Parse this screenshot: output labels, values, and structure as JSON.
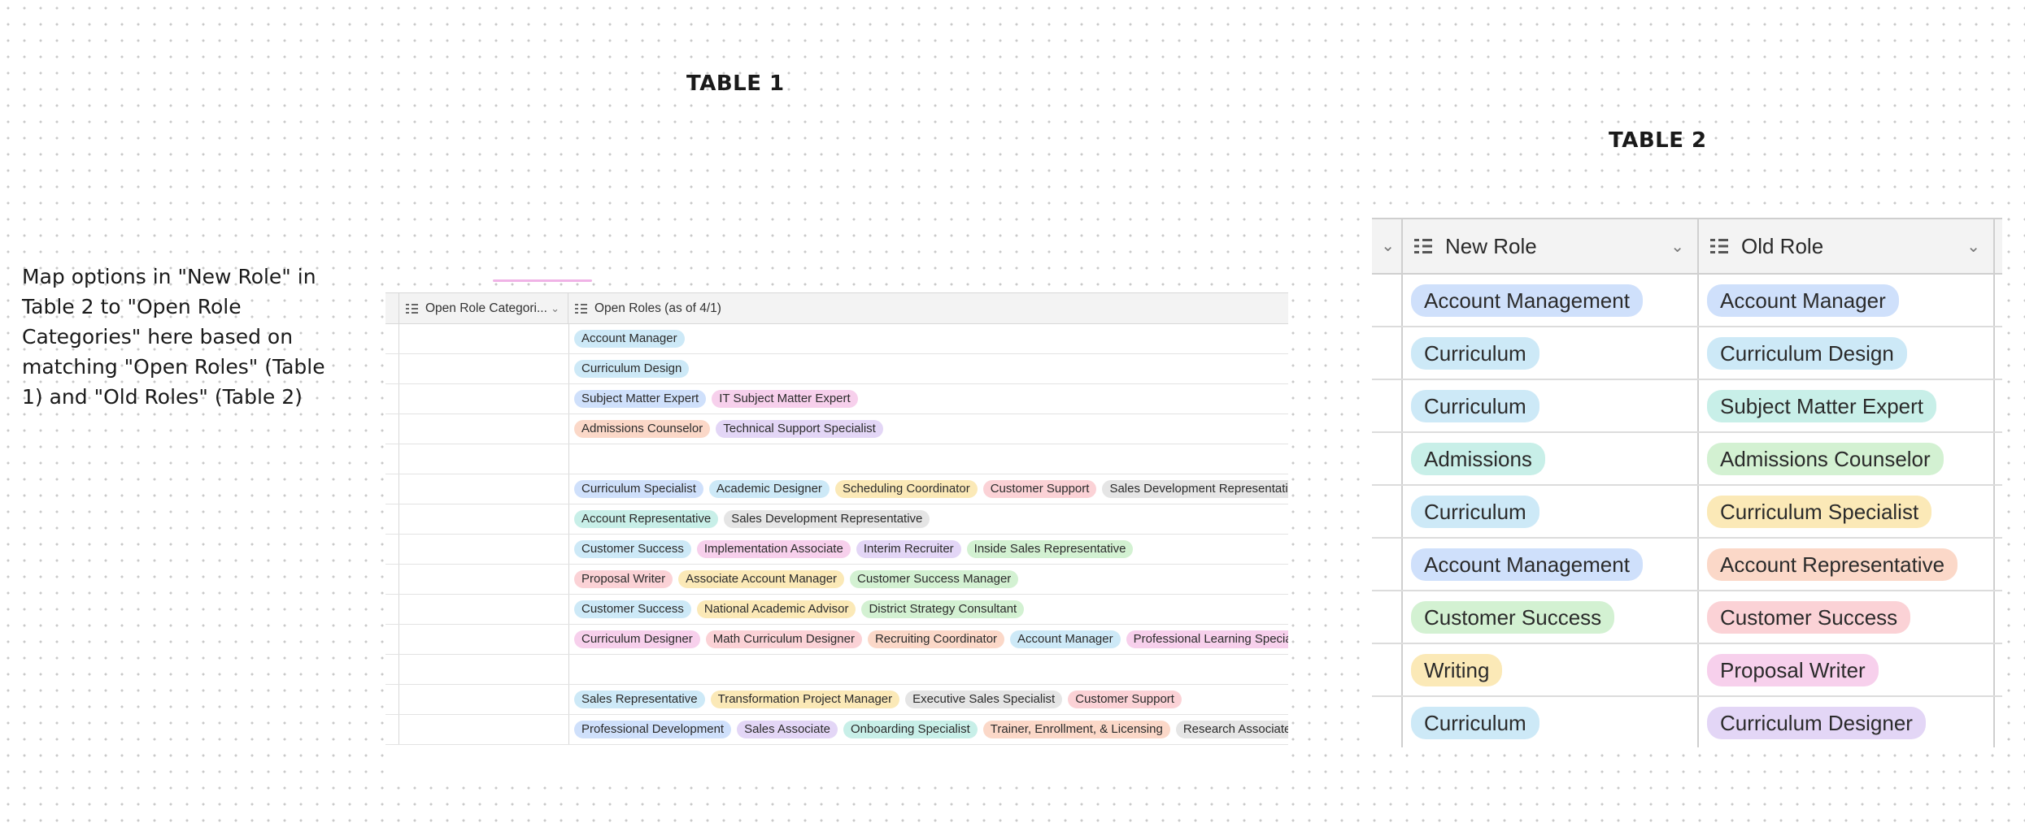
{
  "headings": {
    "table1": "TABLE 1",
    "table2": "TABLE 2"
  },
  "note": "Map options in \"New Role\" in Table 2 to \"Open Role Categories\" here based on matching \"Open Roles\" (Table 1) and \"Old Roles\" (Table 2)",
  "table1": {
    "columns": {
      "categories": "Open Role Categori...",
      "roles": "Open Roles (as of 4/1)"
    },
    "rows": [
      [
        {
          "label": "Account Manager",
          "color": "cyan"
        }
      ],
      [
        {
          "label": "Curriculum Design",
          "color": "cyan"
        }
      ],
      [
        {
          "label": "Subject Matter Expert",
          "color": "blue"
        },
        {
          "label": "IT Subject Matter Expert",
          "color": "pink"
        }
      ],
      [
        {
          "label": "Admissions Counselor",
          "color": "orange"
        },
        {
          "label": "Technical Support Specialist",
          "color": "purple"
        }
      ],
      [],
      [
        {
          "label": "Curriculum Specialist",
          "color": "blue"
        },
        {
          "label": "Academic Designer",
          "color": "cyan"
        },
        {
          "label": "Scheduling Coordinator",
          "color": "yellow"
        },
        {
          "label": "Customer Support",
          "color": "red"
        },
        {
          "label": "Sales Development Representative",
          "color": "gray"
        }
      ],
      [
        {
          "label": "Account Representative",
          "color": "teal"
        },
        {
          "label": "Sales Development Representative",
          "color": "gray"
        }
      ],
      [
        {
          "label": "Customer Success",
          "color": "cyan"
        },
        {
          "label": "Implementation Associate",
          "color": "pink"
        },
        {
          "label": "Interim Recruiter",
          "color": "purple"
        },
        {
          "label": "Inside Sales Representative",
          "color": "green"
        }
      ],
      [
        {
          "label": "Proposal Writer",
          "color": "red"
        },
        {
          "label": "Associate Account Manager",
          "color": "yellow"
        },
        {
          "label": "Customer Success Manager",
          "color": "green"
        }
      ],
      [
        {
          "label": "Customer Success",
          "color": "cyan"
        },
        {
          "label": "National Academic Advisor",
          "color": "yellow"
        },
        {
          "label": "District Strategy Consultant",
          "color": "green"
        }
      ],
      [
        {
          "label": "Curriculum Designer",
          "color": "pink"
        },
        {
          "label": "Math Curriculum Designer",
          "color": "red"
        },
        {
          "label": "Recruiting Coordinator",
          "color": "orange"
        },
        {
          "label": "Account Manager",
          "color": "cyan"
        },
        {
          "label": "Professional Learning Specialist",
          "color": "pink"
        }
      ],
      [],
      [
        {
          "label": "Sales Representative",
          "color": "cyan"
        },
        {
          "label": "Transformation Project Manager",
          "color": "yellow"
        },
        {
          "label": "Executive Sales Specialist",
          "color": "gray"
        },
        {
          "label": "Customer Support",
          "color": "red"
        }
      ],
      [
        {
          "label": "Professional Development",
          "color": "blue"
        },
        {
          "label": "Sales Associate",
          "color": "purple"
        },
        {
          "label": "Onboarding Specialist",
          "color": "teal"
        },
        {
          "label": "Trainer, Enrollment, & Licensing",
          "color": "orange"
        },
        {
          "label": "Research Associate",
          "color": "gray"
        }
      ]
    ]
  },
  "table2": {
    "columns": {
      "new_role": "New Role",
      "old_role": "Old Role"
    },
    "rows": [
      {
        "new": {
          "label": "Account Management",
          "color": "blue"
        },
        "old": {
          "label": "Account Manager",
          "color": "blue"
        }
      },
      {
        "new": {
          "label": "Curriculum",
          "color": "cyan"
        },
        "old": {
          "label": "Curriculum Design",
          "color": "cyan"
        }
      },
      {
        "new": {
          "label": "Curriculum",
          "color": "cyan"
        },
        "old": {
          "label": "Subject Matter Expert",
          "color": "teal"
        }
      },
      {
        "new": {
          "label": "Admissions",
          "color": "teal"
        },
        "old": {
          "label": "Admissions Counselor",
          "color": "green"
        }
      },
      {
        "new": {
          "label": "Curriculum",
          "color": "cyan"
        },
        "old": {
          "label": "Curriculum Specialist",
          "color": "yellow"
        }
      },
      {
        "new": {
          "label": "Account Management",
          "color": "blue"
        },
        "old": {
          "label": "Account Representative",
          "color": "orange"
        }
      },
      {
        "new": {
          "label": "Customer Success",
          "color": "green"
        },
        "old": {
          "label": "Customer Success",
          "color": "red"
        }
      },
      {
        "new": {
          "label": "Writing",
          "color": "yellow"
        },
        "old": {
          "label": "Proposal Writer",
          "color": "pink"
        }
      },
      {
        "new": {
          "label": "Curriculum",
          "color": "cyan"
        },
        "old": {
          "label": "Curriculum Designer",
          "color": "purple"
        }
      }
    ]
  }
}
